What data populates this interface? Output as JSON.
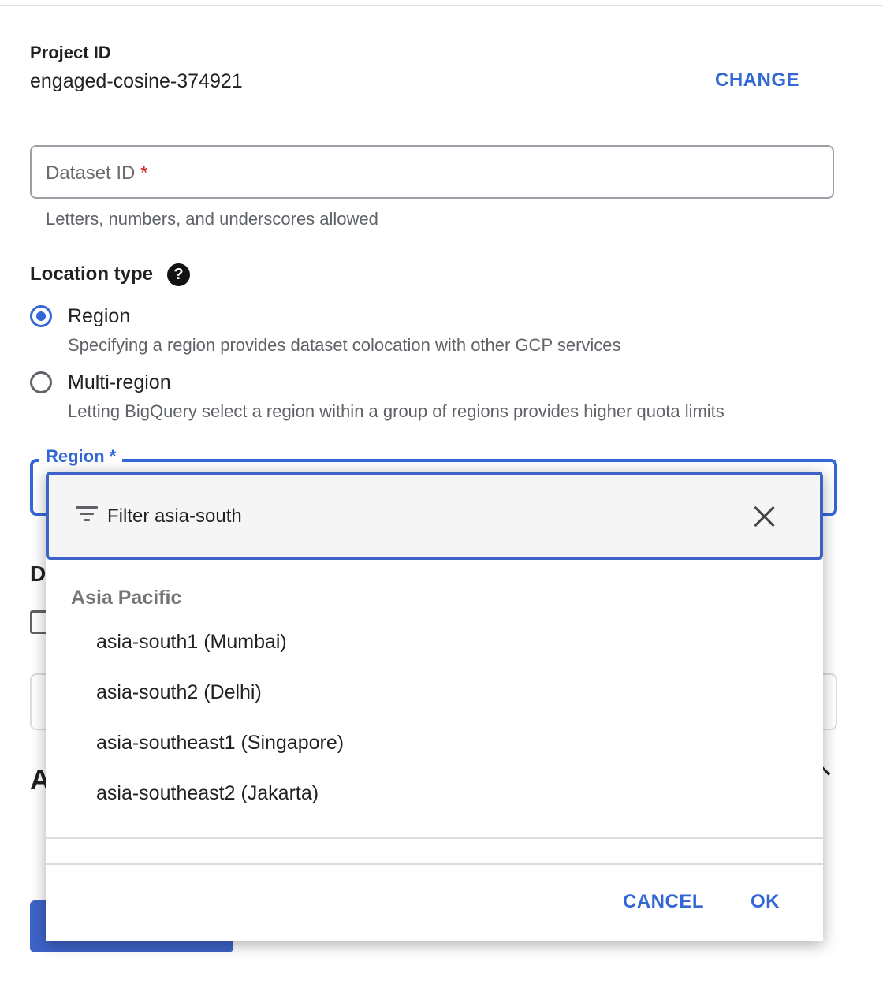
{
  "project": {
    "label": "Project ID",
    "value": "engaged-cosine-374921",
    "change_label": "CHANGE"
  },
  "dataset": {
    "placeholder": "Dataset ID",
    "required_mark": "*",
    "hint": "Letters, numbers, and underscores allowed"
  },
  "location": {
    "title": "Location type",
    "help_icon": "help-circle-icon",
    "help_glyph": "?",
    "options": [
      {
        "label": "Region",
        "description": "Specifying a region provides dataset colocation with other GCP services",
        "selected": true
      },
      {
        "label": "Multi-region",
        "description": "Letting BigQuery select a region within a group of regions provides higher quota limits",
        "selected": false
      }
    ]
  },
  "region_field": {
    "label": "Region *"
  },
  "background": {
    "partial_heading_1": "D",
    "partial_heading_2": "A"
  },
  "dropdown": {
    "filter_icon": "filter-icon",
    "filter_text": "Filter asia-south",
    "close_icon": "close-icon",
    "group_label": "Asia Pacific",
    "options": [
      "asia-south1 (Mumbai)",
      "asia-south2 (Delhi)",
      "asia-southeast1 (Singapore)",
      "asia-southeast2 (Jakarta)"
    ],
    "cancel_label": "CANCEL",
    "ok_label": "OK"
  },
  "colors": {
    "accent": "#3367d6",
    "button_fill": "#3d63c8",
    "required": "#c5221f"
  }
}
